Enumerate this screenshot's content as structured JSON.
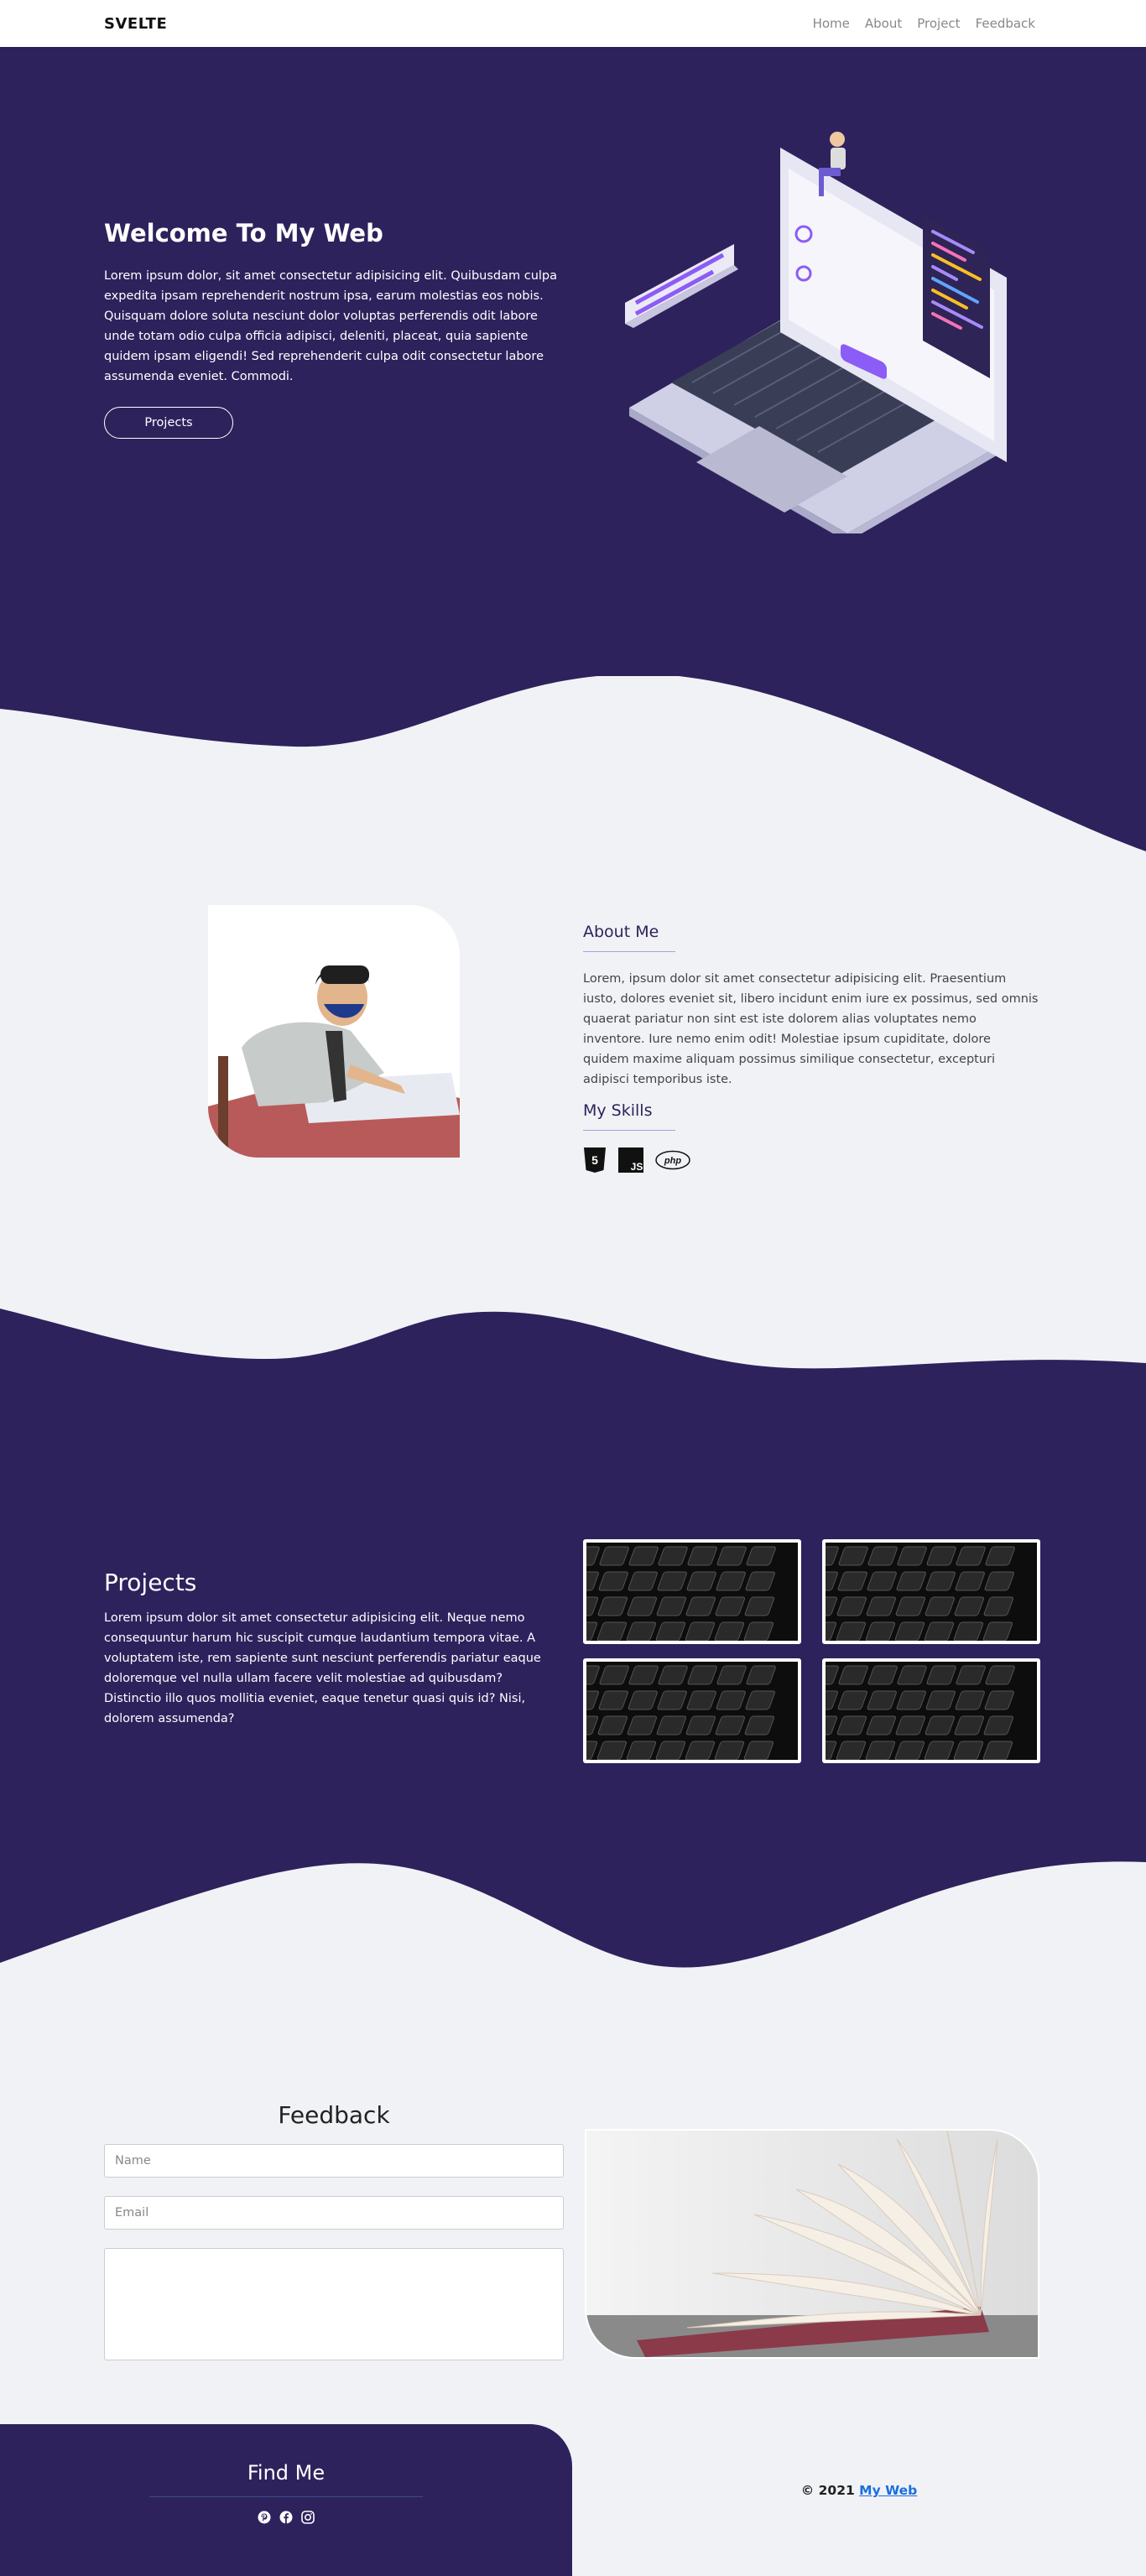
{
  "navbar": {
    "brand": "SVELTE",
    "links": [
      "Home",
      "About",
      "Project",
      "Feedback"
    ]
  },
  "hero": {
    "title": "Welcome To My Web",
    "text": "Lorem ipsum dolor, sit amet consectetur adipisicing elit. Quibusdam culpa expedita ipsam reprehenderit nostrum ipsa, earum molestias eos nobis. Quisquam dolore soluta nesciunt dolor voluptas perferendis odit labore unde totam odio culpa officia adipisci, deleniti, placeat, quia sapiente quidem ipsam eligendi! Sed reprehenderit culpa odit consectetur labore assumenda eveniet. Commodi.",
    "button": "Projects"
  },
  "about": {
    "title": "About Me",
    "text": "Lorem, ipsum dolor sit amet consectetur adipisicing elit. Praesentium iusto, dolores eveniet sit, libero incidunt enim iure ex possimus, sed omnis quaerat pariatur non sint est iste dolorem alias voluptates nemo inventore. Iure nemo enim odit! Molestiae ipsum cupiditate, dolore quidem maxime aliquam possimus similique consectetur, excepturi adipisci temporibus iste.",
    "skills_title": "My Skills",
    "skills": [
      "html5-icon",
      "javascript-icon",
      "php-icon"
    ],
    "php_label": "php",
    "js_label": "JS",
    "html_label": "5"
  },
  "projects": {
    "title": "Projects",
    "text": "Lorem ipsum dolor sit amet consectetur adipisicing elit. Neque nemo consequuntur harum hic suscipit cumque laudantium tempora vitae. A voluptatem iste, rem sapiente sunt nesciunt perferendis pariatur eaque doloremque vel nulla ullam facere velit molestiae ad quibusdam? Distinctio illo quos mollitia eveniet, eaque tenetur quasi quis id? Nisi, dolorem assumenda?"
  },
  "feedback": {
    "title": "Feedback",
    "name_placeholder": "Name",
    "email_placeholder": "Email",
    "message_placeholder": ""
  },
  "footer": {
    "title": "Find Me",
    "socials": [
      "pinterest-icon",
      "facebook-icon",
      "instagram-icon"
    ],
    "copyright_prefix": "© 2021 ",
    "copyright_link": "My Web"
  },
  "colors": {
    "primary": "#2e225c",
    "background": "#f1f2f6",
    "accent": "#8b5cf6",
    "link": "#1a6ee0"
  }
}
